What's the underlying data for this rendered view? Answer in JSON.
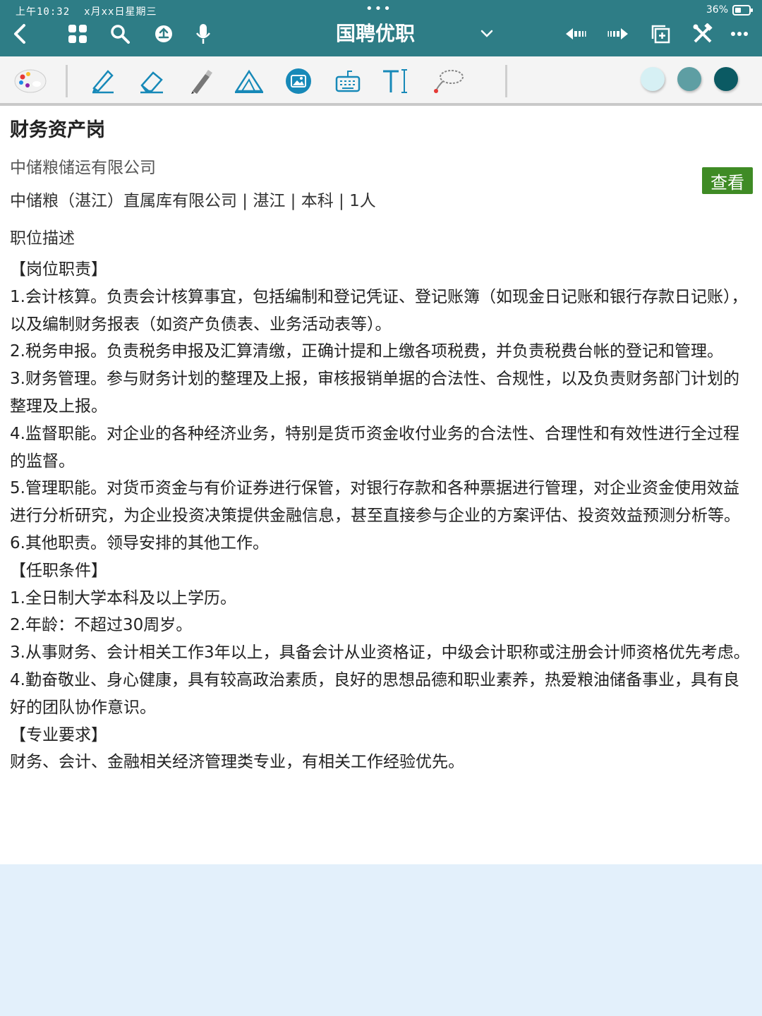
{
  "status": {
    "time": "上午10:32",
    "date": "x月xx日星期三",
    "dots": "•••",
    "battery": "36%"
  },
  "appbar": {
    "title": "国聘优职"
  },
  "job": {
    "title": "财务资产岗",
    "company": "中储粮储运有限公司",
    "meta": "中储粮（湛江）直属库有限公司 | 湛江 | 本科 | 1人",
    "view_button": "查看",
    "section_label": "职位描述",
    "lines": [
      "【岗位职责】",
      "1.会计核算。负责会计核算事宜，包括编制和登记凭证、登记账簿（如现金日记账和银行存款日记账），以及编制财务报表（如资产负债表、业务活动表等）。",
      "2.税务申报。负责税务申报及汇算清缴，正确计提和上缴各项税费，并负责税费台帐的登记和管理。",
      "3.财务管理。参与财务计划的整理及上报，审核报销单据的合法性、合规性，以及负责财务部门计划的整理及上报。",
      "4.监督职能。对企业的各种经济业务，特别是货币资金收付业务的合法性、合理性和有效性进行全过程的监督。",
      "5.管理职能。对货币资金与有价证券进行保管，对银行存款和各种票据进行管理，对企业资金使用效益进行分析研究，为企业投资决策提供金融信息，甚至直接参与企业的方案评估、投资效益预测分析等。",
      "6.其他职责。领导安排的其他工作。",
      "【任职条件】",
      "1.全日制大学本科及以上学历。",
      "2.年龄：不超过30周岁。",
      "3.从事财务、会计相关工作3年以上，具备会计从业资格证，中级会计职称或注册会计师资格优先考虑。",
      "4.勤奋敬业、身心健康，具有较高政治素质，良好的思想品德和职业素养，热爱粮油储备事业，具有良好的团队协作意识。",
      "【专业要求】",
      "财务、会计、金融相关经济管理类专业，有相关工作经验优先。"
    ]
  },
  "colors": {
    "appbar": "#2e7d86",
    "view_button": "#3f8b25",
    "stroke_blue": "#1789b8",
    "dot_light": "#d6f0f4",
    "dot_mid": "#5e9ea3",
    "dot_dark": "#0b5a63"
  }
}
